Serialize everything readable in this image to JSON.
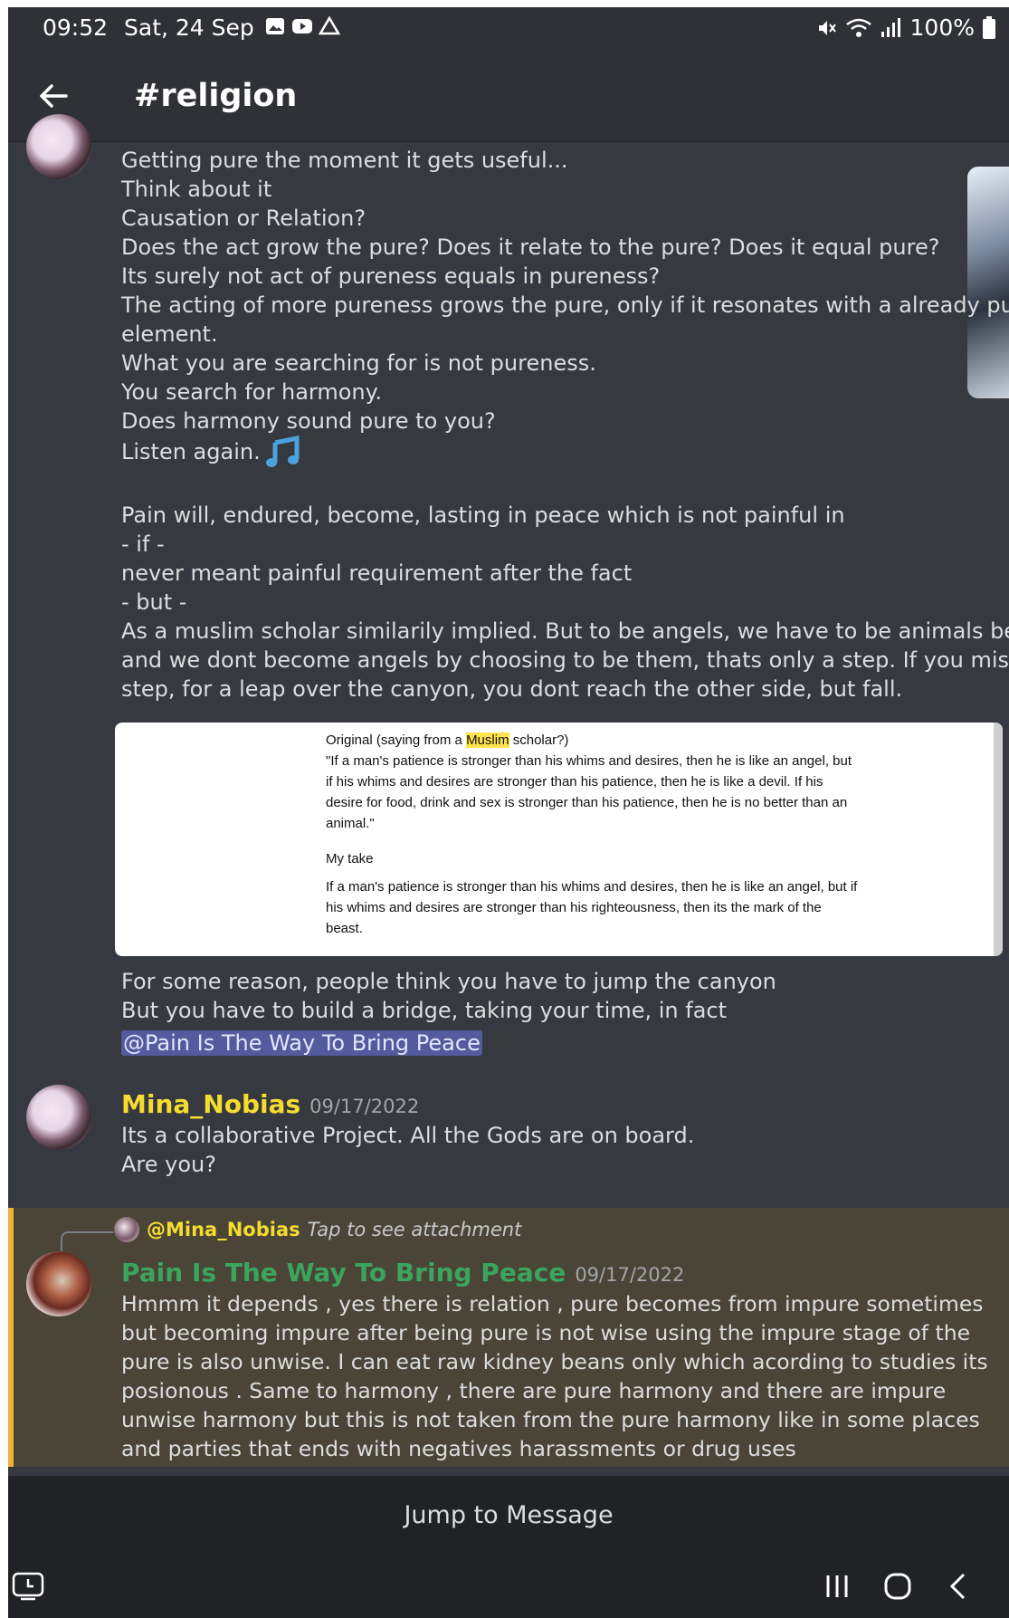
{
  "status_bar": {
    "time": "09:52",
    "date": "Sat, 24 Sep",
    "battery": "100%",
    "notification_icons": [
      "gallery-icon",
      "youtube-icon",
      "drive-icon"
    ],
    "status_icons": [
      "mute-vibrate-icon",
      "wifi-icon",
      "signal-icon",
      "battery-icon"
    ]
  },
  "header": {
    "channel": "#religion"
  },
  "message1": {
    "lines_a": [
      "Getting pure the moment it gets useful...",
      "Think about it",
      "Causation or Relation?",
      "Does the act grow the pure? Does it relate to the pure? Does it equal pure?",
      "Its surely not act of pureness equals in pureness?",
      "The acting of more pureness grows the pure, only if it resonates with a already pure enoug",
      "element.",
      "What you are searching for is not pureness.",
      "You search for harmony.",
      "Does harmony sound pure to you?",
      "Listen again."
    ],
    "lines_b": [
      "Pain will, endured, become, lasting in peace which is not painful in",
      "- if -",
      " never meant painful requirement after the fact",
      "- but -",
      "As a muslim scholar similarily implied. But to be angels, we have to be animals before that,",
      "and we dont become angels by choosing to be them, thats only a step. If you mistake this",
      "step, for a leap over the canyon, you dont reach the other side, but fall."
    ],
    "lines_c": [
      "For some reason, people think you have to jump the canyon",
      "But you have to build a bridge, taking your time, in fact"
    ],
    "mention": "@Pain Is The Way To Bring Peace"
  },
  "quote_image": {
    "original_prefix": "Original (saying from a ",
    "original_highlight": "Muslim",
    "original_suffix": " scholar?)",
    "original_lines": [
      "\"If a man's patience is stronger than his whims and desires, then he is like an angel, but",
      "if his whims and desires are stronger than his patience, then he is like a devil. If his",
      "desire for food, drink and sex is stronger than his patience, then he is no better than an",
      "animal.\""
    ],
    "take_heading": "My take",
    "take_lines": [
      "If a man's patience is stronger than his whims and desires, then he is like an angel, but if",
      "his whims and desires are stronger than his righteousness, then its the mark of the",
      "beast."
    ]
  },
  "message2": {
    "author": "Mina_Nobias",
    "author_color": "#f5dc2f",
    "timestamp": "09/17/2022",
    "lines": [
      "Its a collaborative Project. All the Gods are on board.",
      "Are you?"
    ]
  },
  "message3": {
    "reply_author": "@Mina_Nobias",
    "reply_text": "Tap to see attachment",
    "author": "Pain Is The Way To Bring Peace",
    "author_color": "#3ba55d",
    "timestamp": "09/17/2022",
    "text": "Hmmm it depends , yes there is relation , pure becomes from impure sometimes but becoming impure after being pure is not wise using the impure stage of the pure is also unwise. I can eat raw kidney beans only which acording to studies its posionous . Same to harmony , there are pure harmony and there are impure unwise harmony but this is not taken from the pure harmony like in some places and parties that ends with negatives harassments or drug uses",
    "highlight_color": "#f0b232"
  },
  "jump_bar": {
    "label": "Jump to Message"
  },
  "nav": {
    "icons": [
      "keyboard-toggle-icon",
      "recents-icon",
      "home-icon",
      "back-icon"
    ]
  }
}
